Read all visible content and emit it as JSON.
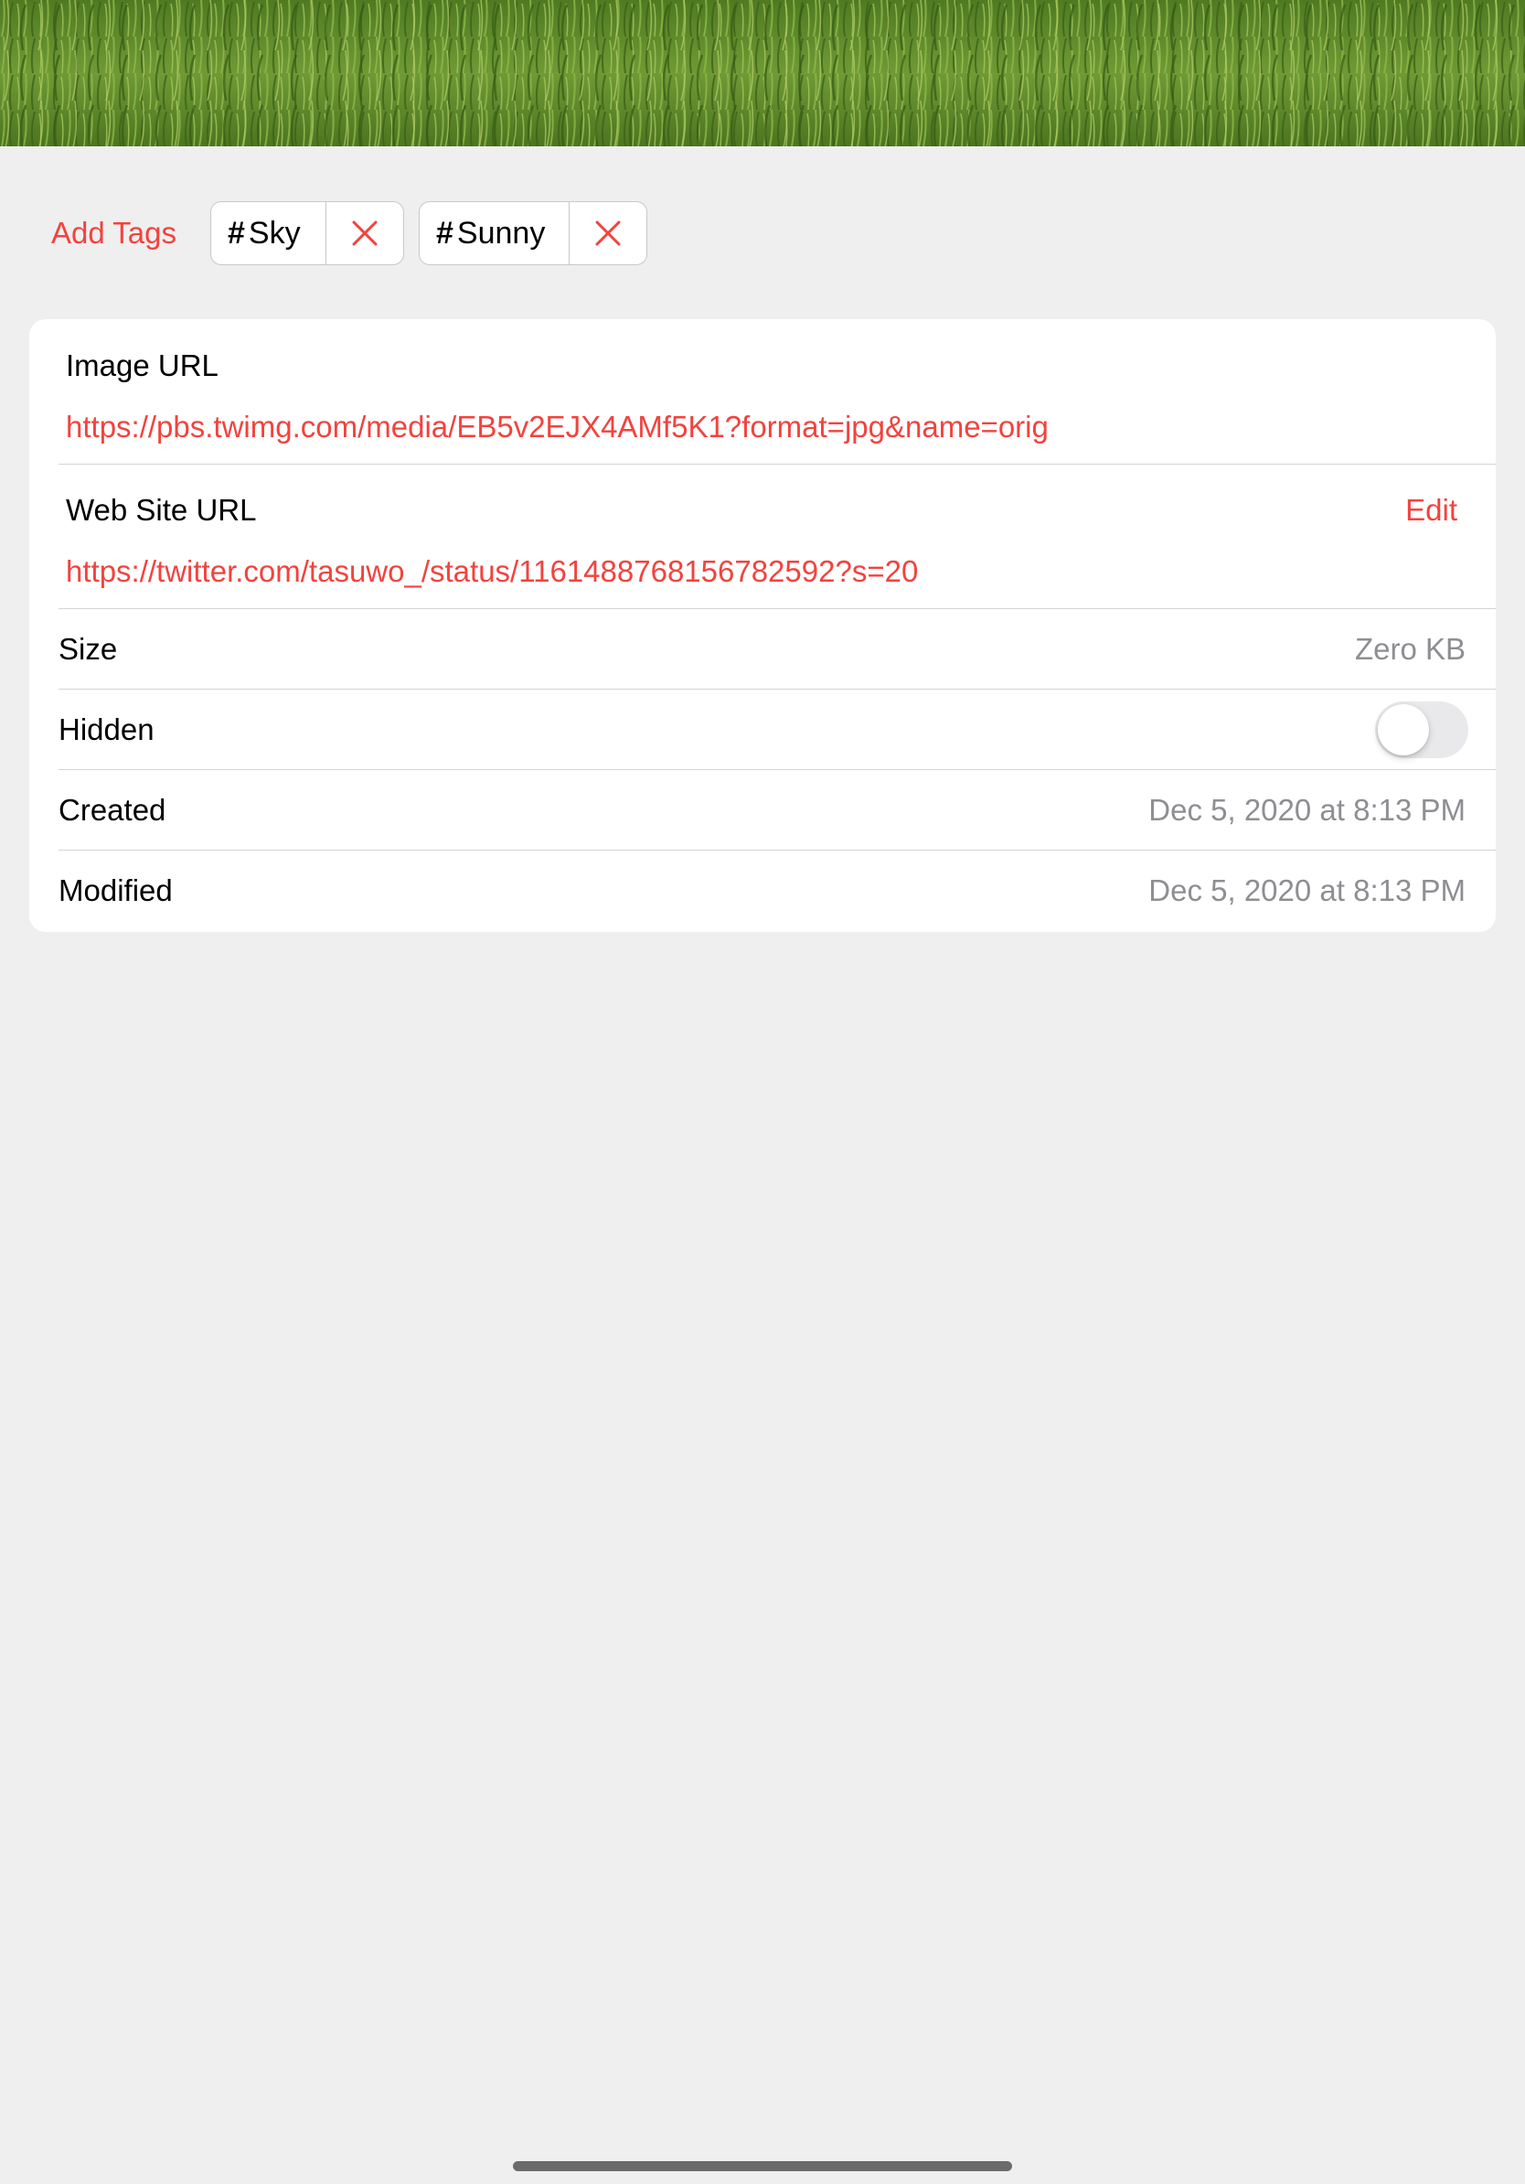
{
  "header": {
    "image_description_icon": "grass-field-photo"
  },
  "tags": {
    "add_label": "Add Tags",
    "hash_symbol": "#",
    "items": [
      {
        "label": "Sky"
      },
      {
        "label": "Sunny"
      }
    ],
    "remove_icon": "close-icon"
  },
  "details": {
    "image_url": {
      "label": "Image URL",
      "value": "https://pbs.twimg.com/media/EB5v2EJX4AMf5K1?format=jpg&name=orig"
    },
    "web_site_url": {
      "label": "Web Site URL",
      "edit_label": "Edit",
      "value": "https://twitter.com/tasuwo_/status/1161488768156782592?s=20"
    },
    "size": {
      "label": "Size",
      "value": "Zero KB"
    },
    "hidden": {
      "label": "Hidden",
      "on": false
    },
    "created": {
      "label": "Created",
      "value": "Dec 5, 2020 at 8:13 PM"
    },
    "modified": {
      "label": "Modified",
      "value": "Dec 5, 2020 at 8:13 PM"
    }
  },
  "colors": {
    "accent": "#f2433e",
    "background": "#efefef",
    "card": "#ffffff",
    "secondary_text": "#8e8e93"
  }
}
